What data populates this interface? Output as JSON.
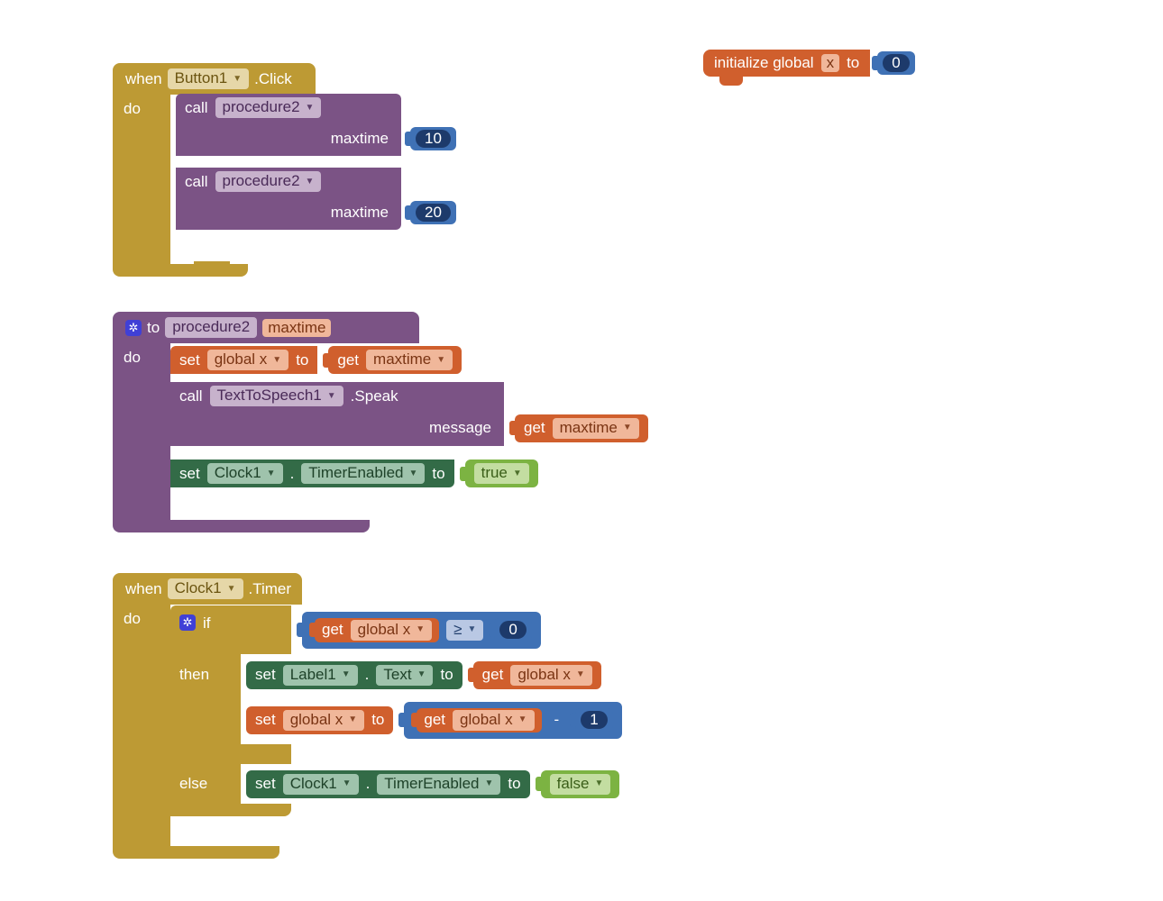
{
  "init": {
    "prefix": "initialize global",
    "varname": "x",
    "to": "to",
    "value": "0"
  },
  "event1": {
    "when": "when",
    "component": "Button1",
    "suffix": ".Click",
    "do": "do",
    "calls": [
      {
        "call": "call",
        "proc": "procedure2",
        "param": "maxtime",
        "value": "10"
      },
      {
        "call": "call",
        "proc": "procedure2",
        "param": "maxtime",
        "value": "20"
      }
    ]
  },
  "procdef": {
    "to": "to",
    "name": "procedure2",
    "arg": "maxtime",
    "do": "do",
    "line1": {
      "set": "set",
      "var": "global x",
      "to": "to",
      "get": "get",
      "src": "maxtime"
    },
    "line2": {
      "call": "call",
      "component": "TextToSpeech1",
      "method": ".Speak",
      "msglabel": "message",
      "get": "get",
      "src": "maxtime"
    },
    "line3": {
      "set": "set",
      "component": "Clock1",
      "dot": ".",
      "prop": "TimerEnabled",
      "to": "to",
      "value": "true"
    }
  },
  "event2": {
    "when": "when",
    "component": "Clock1",
    "suffix": ".Timer",
    "do": "do",
    "ifkw": "if",
    "thenkw": "then",
    "elsekw": "else",
    "cond": {
      "get": "get",
      "var": "global x",
      "op": "≥",
      "rhs": "0"
    },
    "then1": {
      "set": "set",
      "component": "Label1",
      "dot": ".",
      "prop": "Text",
      "to": "to",
      "get": "get",
      "src": "global x"
    },
    "then2": {
      "set": "set",
      "var": "global x",
      "to": "to",
      "get": "get",
      "src": "global x",
      "minus": "-",
      "rhs": "1"
    },
    "else1": {
      "set": "set",
      "component": "Clock1",
      "dot": ".",
      "prop": "TimerEnabled",
      "to": "to",
      "value": "false"
    }
  }
}
